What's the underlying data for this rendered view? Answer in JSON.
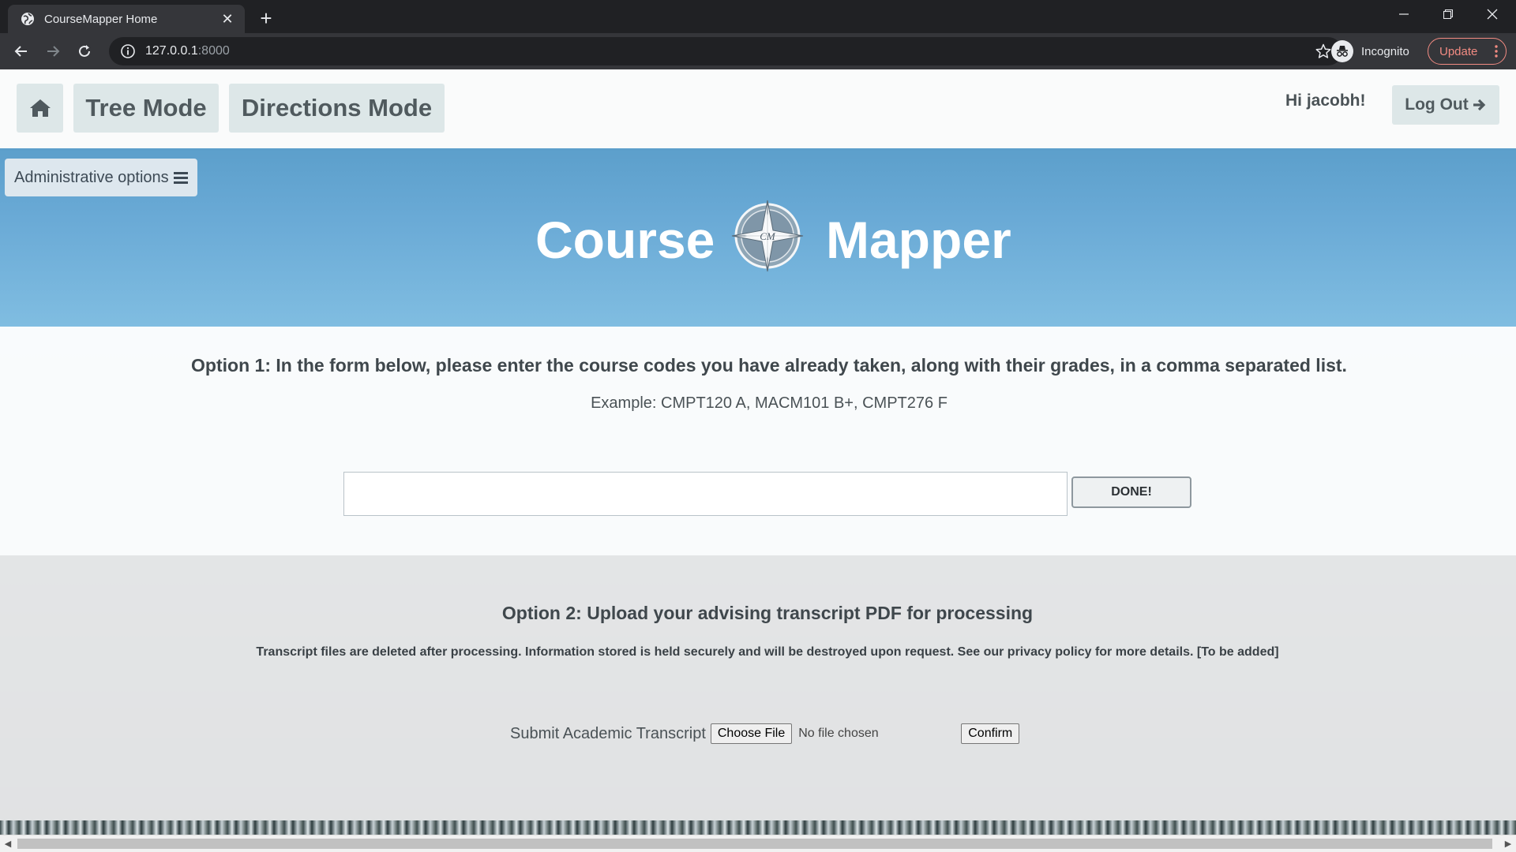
{
  "browser": {
    "tab_title": "CourseMapper Home",
    "url_host": "127.0.0.1",
    "url_port": ":8000",
    "incognito_label": "Incognito",
    "update_label": "Update"
  },
  "nav": {
    "tree_mode": "Tree Mode",
    "directions_mode": "Directions Mode",
    "greeting": "Hi jacobh!",
    "logout": "Log Out"
  },
  "hero": {
    "admin_options": "Administrative options",
    "brand_left": "Course",
    "brand_right": "Mapper",
    "compass_text": "CM"
  },
  "option1": {
    "title": "Option 1: In the form below, please enter the course codes you have already taken, along with their grades, in a comma separated list.",
    "example": "Example: CMPT120 A, MACM101 B+, CMPT276 F",
    "input_value": "",
    "done_label": "DONE!"
  },
  "option2": {
    "title": "Option 2: Upload your advising transcript PDF for processing",
    "note": "Transcript files are deleted after processing. Information stored is held securely and will be destroyed upon request. See our privacy policy for more details. [To be added]",
    "upload_label": "Submit Academic Transcript",
    "choose_file": "Choose File",
    "no_file": "No file chosen",
    "confirm": "Confirm"
  },
  "colors": {
    "hero_blue": "#6aaad6",
    "button_bg": "#dde7e8",
    "update_red": "#f28b82"
  },
  "icons": [
    "globe-icon",
    "close-icon",
    "plus-icon",
    "minimize-icon",
    "restore-icon",
    "window-close-icon",
    "back-arrow-icon",
    "forward-arrow-icon",
    "reload-icon",
    "info-icon",
    "star-icon",
    "incognito-icon",
    "more-vert-icon",
    "home-icon",
    "arrow-right-icon",
    "hamburger-icon",
    "compass-icon"
  ]
}
